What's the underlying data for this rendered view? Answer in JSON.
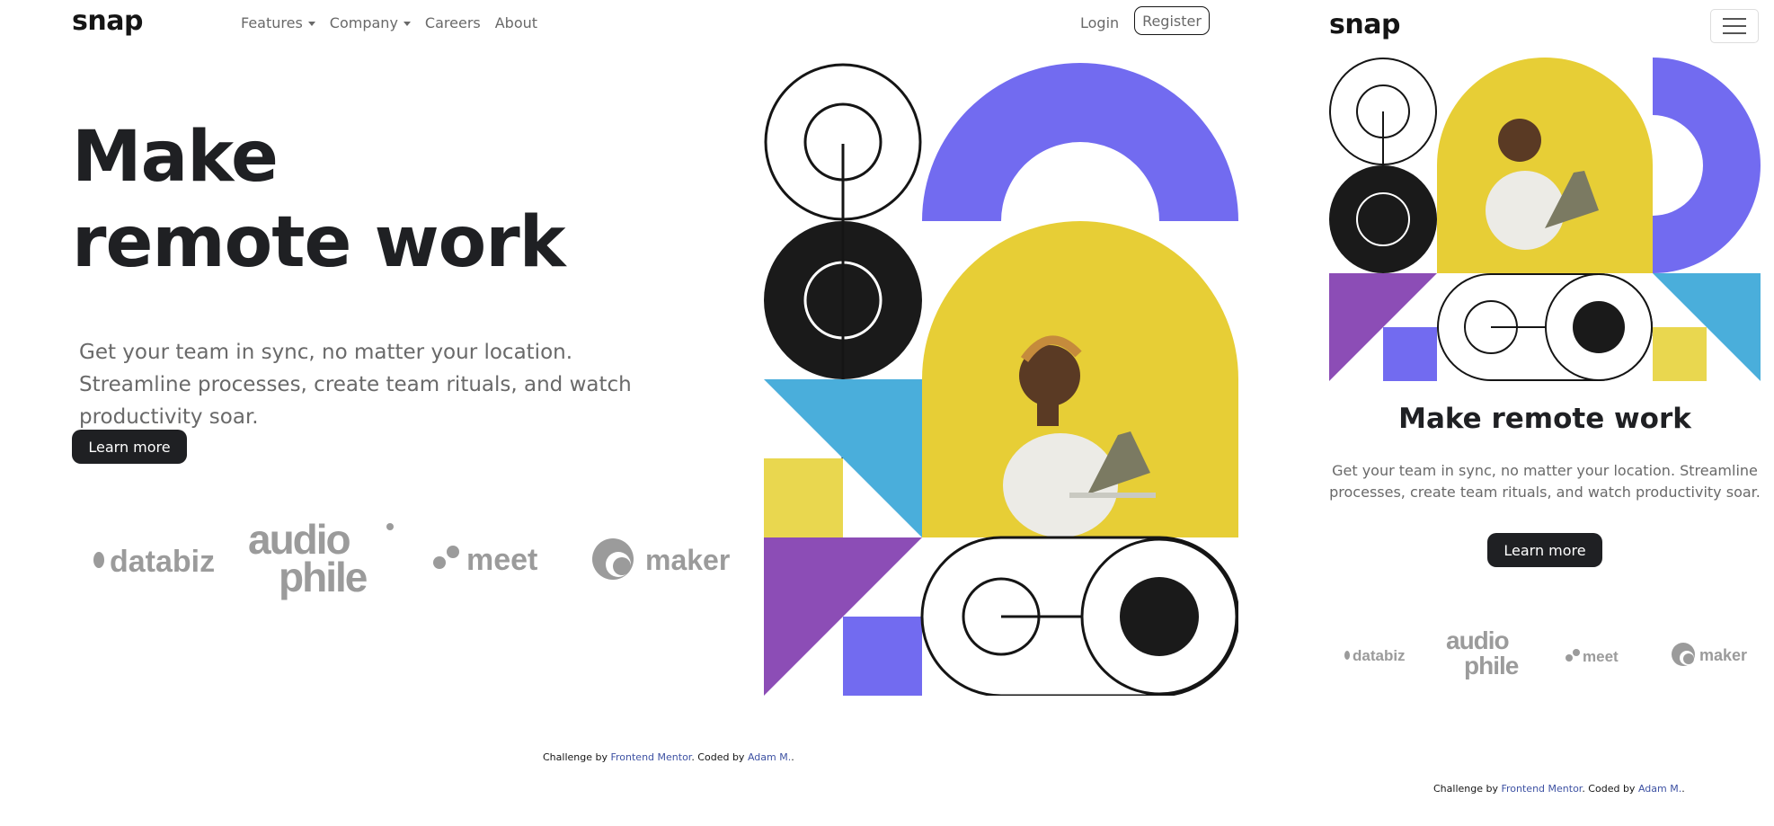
{
  "brand": "snap",
  "nav": {
    "features": "Features",
    "company": "Company",
    "careers": "Careers",
    "about": "About",
    "login": "Login",
    "register": "Register"
  },
  "hero": {
    "title_line1": "Make",
    "title_line2": "remote work",
    "title_mobile": "Make remote work",
    "subtitle": "Get your team in sync, no matter your location. Streamline processes, create team rituals, and watch productivity soar.",
    "cta": "Learn more"
  },
  "clients": [
    "databiz",
    "audio",
    "phile",
    "meet",
    "maker"
  ],
  "credit": {
    "prefix": "Challenge by ",
    "frontend_mentor": "Frontend Mentor",
    "middle": ". Coded by ",
    "author": "Adam M.",
    "suffix": "."
  },
  "colors": {
    "dark": "#1f2023",
    "gray": "#696969",
    "purple": "#726bf0",
    "blue": "#4aaedb",
    "yellow": "#e9d74f",
    "violet": "#8c4db6",
    "link": "#3e52a3"
  },
  "icons": [
    "caret-down-icon",
    "hamburger-menu-icon"
  ]
}
